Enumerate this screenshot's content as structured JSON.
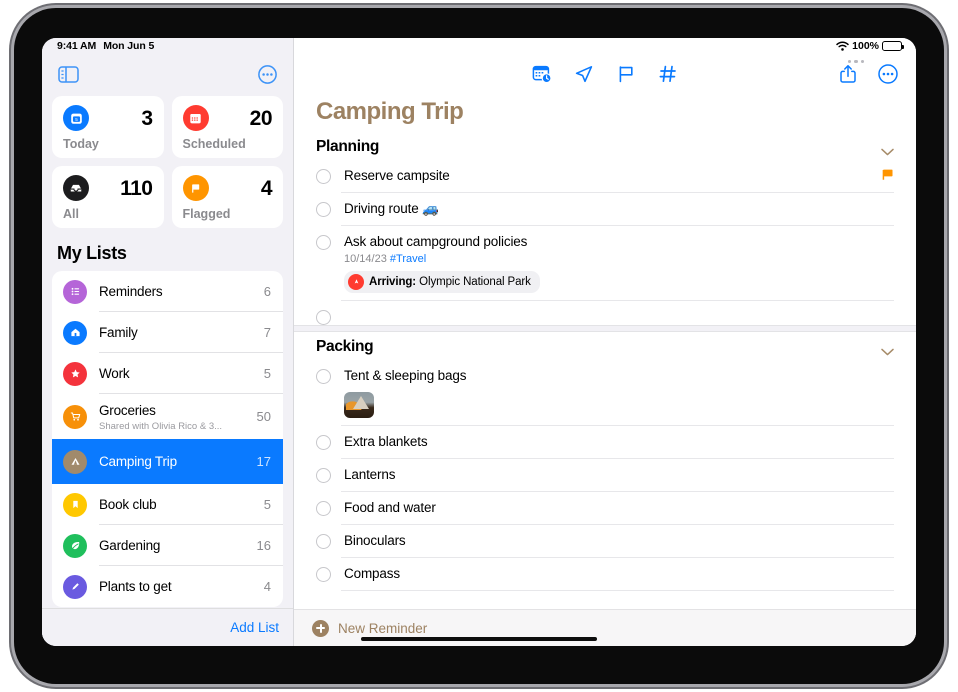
{
  "statusbar": {
    "time": "9:41 AM",
    "date": "Mon Jun 5",
    "battery_percent": "100%",
    "wifi_icon": "wifi-icon",
    "battery_icon": "battery-icon"
  },
  "sidebar": {
    "panel_icon": "sidebar-toggle-icon",
    "more_icon": "more-circle-icon",
    "smart_lists": [
      {
        "label": "Today",
        "count": "3",
        "icon": "today-calendar-icon",
        "color": "#0a7aff"
      },
      {
        "label": "Scheduled",
        "count": "20",
        "icon": "scheduled-calendar-icon",
        "color": "#ff3b30"
      },
      {
        "label": "All",
        "count": "110",
        "icon": "all-inbox-icon",
        "color": "#1c1c1e"
      },
      {
        "label": "Flagged",
        "count": "4",
        "icon": "flag-icon",
        "color": "#ff9500"
      }
    ],
    "my_lists_header": "My Lists",
    "lists": [
      {
        "name": "Reminders",
        "count": "6",
        "icon": "list-bullet-icon",
        "color": "#b565d8",
        "subtitle": "",
        "selected": false
      },
      {
        "name": "Family",
        "count": "7",
        "icon": "house-icon",
        "color": "#0a7aff",
        "subtitle": "",
        "selected": false
      },
      {
        "name": "Work",
        "count": "5",
        "icon": "star-icon",
        "color": "#f4333c",
        "subtitle": "",
        "selected": false
      },
      {
        "name": "Groceries",
        "count": "50",
        "icon": "cart-icon",
        "color": "#f79009",
        "subtitle": "Shared with Olivia Rico & 3...",
        "selected": false
      },
      {
        "name": "Camping Trip",
        "count": "17",
        "icon": "tent-icon",
        "color": "#a18a6b",
        "subtitle": "",
        "selected": true
      },
      {
        "name": "Book club",
        "count": "5",
        "icon": "bookmark-icon",
        "color": "#ffc800",
        "subtitle": "",
        "selected": false
      },
      {
        "name": "Gardening",
        "count": "16",
        "icon": "leaf-icon",
        "color": "#1fbf5c",
        "subtitle": "",
        "selected": false
      },
      {
        "name": "Plants to get",
        "count": "4",
        "icon": "pen-icon",
        "color": "#6a5ae0",
        "subtitle": "",
        "selected": false
      }
    ],
    "add_list_label": "Add List"
  },
  "detail": {
    "title": "Camping Trip",
    "accent_color": "#9d8262",
    "toolbar": {
      "center_icons": [
        {
          "name": "calendar-clock-icon",
          "label": "Date & Time"
        },
        {
          "name": "location-arrow-icon",
          "label": "Location"
        },
        {
          "name": "flag-outline-icon",
          "label": "Flag"
        },
        {
          "name": "hashtag-icon",
          "label": "Tag"
        }
      ],
      "right_icons": [
        {
          "name": "share-icon",
          "label": "Share"
        },
        {
          "name": "more-circle-icon",
          "label": "More"
        }
      ]
    },
    "sections": [
      {
        "title": "Planning",
        "collapse_icon": "chevron-down-icon",
        "tasks": [
          {
            "title": "Reserve campsite",
            "meta": "",
            "tag": "",
            "flagged": true,
            "location_badge": null,
            "thumbnail": false
          },
          {
            "title": "Driving route 🚙",
            "meta": "",
            "tag": "",
            "flagged": false,
            "location_badge": null,
            "thumbnail": false
          },
          {
            "title": "Ask about campground policies",
            "meta": "10/14/23",
            "tag": "#Travel",
            "flagged": false,
            "location_badge": {
              "prefix": "Arriving:",
              "place": "Olympic National Park",
              "icon": "location-pin-icon"
            },
            "thumbnail": false
          },
          {
            "title": "",
            "meta": "",
            "tag": "",
            "flagged": false,
            "location_badge": null,
            "thumbnail": false
          }
        ]
      },
      {
        "title": "Packing",
        "collapse_icon": "chevron-down-icon",
        "tasks": [
          {
            "title": "Tent & sleeping bags",
            "meta": "",
            "tag": "",
            "flagged": false,
            "location_badge": null,
            "thumbnail": true
          },
          {
            "title": "Extra blankets",
            "meta": "",
            "tag": "",
            "flagged": false,
            "location_badge": null,
            "thumbnail": false
          },
          {
            "title": "Lanterns",
            "meta": "",
            "tag": "",
            "flagged": false,
            "location_badge": null,
            "thumbnail": false
          },
          {
            "title": "Food and water",
            "meta": "",
            "tag": "",
            "flagged": false,
            "location_badge": null,
            "thumbnail": false
          },
          {
            "title": "Binoculars",
            "meta": "",
            "tag": "",
            "flagged": false,
            "location_badge": null,
            "thumbnail": false
          },
          {
            "title": "Compass",
            "meta": "",
            "tag": "",
            "flagged": false,
            "location_badge": null,
            "thumbnail": false
          }
        ]
      }
    ],
    "new_reminder_label": "New Reminder",
    "new_reminder_icon": "plus-circle-icon"
  }
}
